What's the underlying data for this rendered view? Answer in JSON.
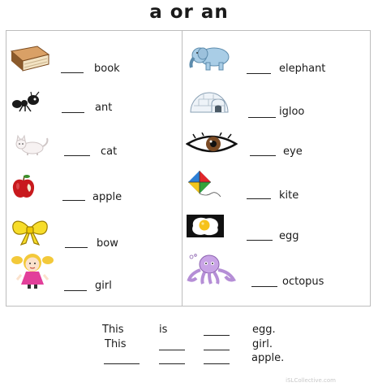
{
  "title": "a or an",
  "left_items": [
    {
      "word": "book",
      "icon": "book-icon"
    },
    {
      "word": "ant",
      "icon": "ant-icon"
    },
    {
      "word": "cat",
      "icon": "cat-icon"
    },
    {
      "word": "apple",
      "icon": "apple-icon"
    },
    {
      "word": "bow",
      "icon": "bow-icon"
    },
    {
      "word": "girl",
      "icon": "girl-icon"
    }
  ],
  "right_items": [
    {
      "word": "elephant",
      "icon": "elephant-icon"
    },
    {
      "word": "igloo",
      "icon": "igloo-icon"
    },
    {
      "word": "eye",
      "icon": "eye-icon"
    },
    {
      "word": "kite",
      "icon": "kite-icon"
    },
    {
      "word": "egg",
      "icon": "egg-icon"
    },
    {
      "word": "octopus",
      "icon": "octopus-icon"
    }
  ],
  "sentences": [
    {
      "words": [
        "This",
        "is",
        "egg."
      ]
    },
    {
      "words": [
        "This",
        "girl."
      ]
    },
    {
      "words": [
        "apple."
      ]
    }
  ],
  "watermark": "iSLCollective.com"
}
